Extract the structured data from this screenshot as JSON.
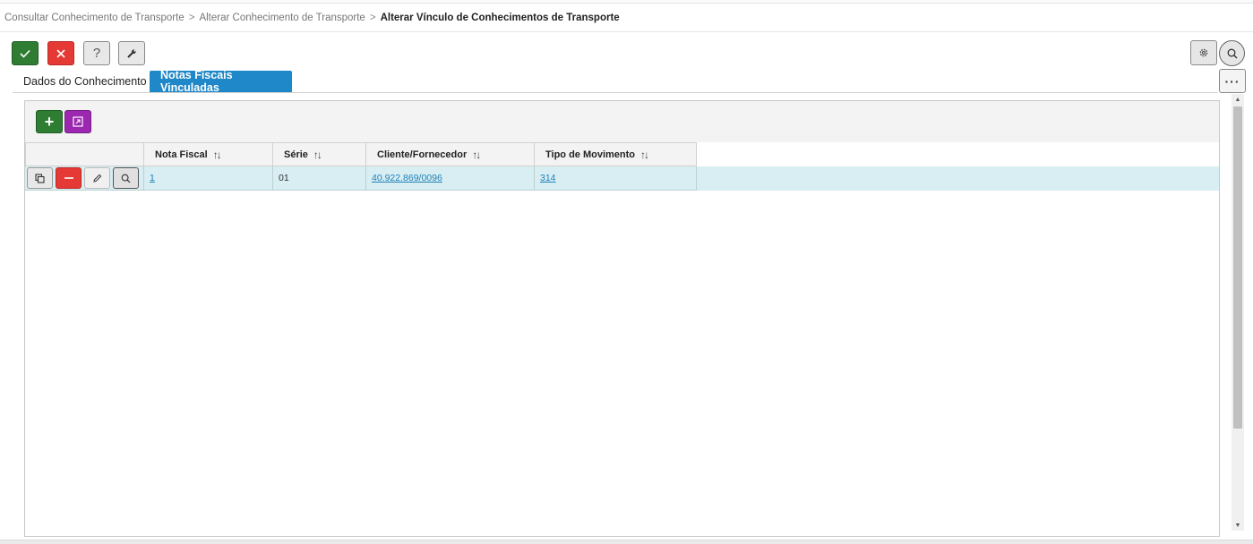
{
  "breadcrumb": {
    "items": [
      "Consultar Conhecimento de Transporte",
      "Alterar Conhecimento de Transporte"
    ],
    "separator": ">",
    "current": "Alterar Vínculo de Conhecimentos de Transporte"
  },
  "toolbar": {
    "confirm_icon": "check-icon",
    "cancel_icon": "close-icon",
    "help_label": "?",
    "tools_icon": "wrench-icon"
  },
  "top_right": {
    "settings_icon": "gear-icon",
    "search_icon": "search-icon",
    "more_label": "···"
  },
  "tabs": [
    {
      "label": "Dados do Conhecimento",
      "active": false
    },
    {
      "label": "Notas Fiscais Vinculadas",
      "active": true
    }
  ],
  "panel_toolbar": {
    "add_label": "+",
    "open_icon": "open-window-icon"
  },
  "grid": {
    "columns": [
      {
        "label": "Nota Fiscal"
      },
      {
        "label": "Série"
      },
      {
        "label": "Cliente/Fornecedor"
      },
      {
        "label": "Tipo de Movimento"
      }
    ],
    "sort_glyph": "↑↓",
    "rows": [
      {
        "nota_fiscal": "1",
        "serie": "01",
        "cliente": "40.922.869/0096",
        "tipo_movimento": "314"
      }
    ]
  },
  "colors": {
    "success": "#2e7d32",
    "danger": "#e53935",
    "tab_active": "#1e88c8",
    "purple": "#9c27b0",
    "row_highlight": "#d8eef2",
    "link": "#1e7fb8"
  }
}
